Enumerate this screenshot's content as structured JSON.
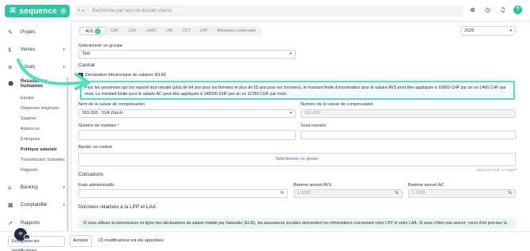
{
  "topbar": {
    "logo_mark": "⌘",
    "logo_text": "sequence",
    "logo_pill": "⌾",
    "search_placeholder": "Recherche par nom de dossier clients",
    "icons": [
      "add-circle-icon",
      "clock-icon",
      "bell-icon"
    ],
    "avatar_initial": "?"
  },
  "sidebar": {
    "items": [
      {
        "label": "Projets",
        "icon": "✎"
      },
      {
        "label": "Ventes",
        "icon": "$"
      },
      {
        "label": "Achats",
        "icon": "≡"
      },
      {
        "label": "Ressources humaines",
        "icon": "☻"
      },
      {
        "label": "Banking",
        "icon": "⌂"
      },
      {
        "label": "Comptabilité",
        "icon": "▦"
      },
      {
        "label": "Rapports",
        "icon": "↗"
      }
    ],
    "sub_items": [
      "Equipe",
      "Dépenses employés",
      "Salaires",
      "Absences",
      "Entreprise",
      "Politique salariale",
      "Transmission Swissdec",
      "Rapports"
    ]
  },
  "tabs": [
    {
      "label": "AVS",
      "badge": "1"
    },
    {
      "label": "CAF"
    },
    {
      "label": "LAA"
    },
    {
      "label": "LAAC"
    },
    {
      "label": "IJM"
    },
    {
      "label": "CCT"
    },
    {
      "label": "LPP"
    },
    {
      "label": "Retenues cantonales"
    }
  ],
  "year": "2026",
  "form": {
    "group_label": "Sélectionner un groupe",
    "group_value": "Test",
    "contract_section": "Contrat",
    "elm_label": "Déclaration électronique de salaires (ELM)",
    "info_text": "Pour les personnes qui ont reporté leur retraite (plus de 64 ans pour les femmes et plus de 65 ans pour les hommes), le montant limite d'exonération pour le salaire AVS peut être appliquée à 16800 CHF par an ou 1400 CHF par mois. Le montant limite pour le salaire AC peut être appliquée à 148200 CHF par an ou 12350 CHF par mois.",
    "caisse_name_label": "Nom de la caisse de compensation",
    "caisse_name_value": "001.000 - SVA Zürich",
    "caisse_number_label": "Numéro de la caisse de compensation",
    "caisse_number_value": "001.000",
    "member_label": "Numéro de membre *",
    "member_value": "",
    "subnumber_label": "Sous-numéro",
    "subnumber_value": "",
    "contract_add_label": "Ajouter un contrat",
    "upload_label": "Sélectionner ou glisser",
    "upload_hint": "application/pdf ou image/*",
    "cotisations_section": "Cotisations",
    "frais_label": "Frais administratifs",
    "frais_value": "",
    "avs_label": "Barème annuel AVS",
    "avs_value": "5,3000",
    "ac_label": "Barème annuel AC",
    "ac_value": "1,1000",
    "percent": "%",
    "lpp_section": "Données relatives à la LPP et LAA",
    "lpp_info": "Si vous utilisez la transmission en ligne des déclarations de salaire établie par Swissdec (ELM), les assurances sociales demandent les informations concernant votre LPP et votre LAA. Si vous n'êtes pas assuré, merci d'en préciser la raison."
  },
  "bottombar": {
    "save_label": "Enregistrer les modifications",
    "cancel_label": "Annuler",
    "modifications_text": "(2) modifications ont été apportées",
    "chat_badge": "46"
  },
  "colors": {
    "brand": "#2ec6a2",
    "highlight_border": "#4fe0c0",
    "dark": "#1f2d3d",
    "link": "#2e6fb3"
  }
}
